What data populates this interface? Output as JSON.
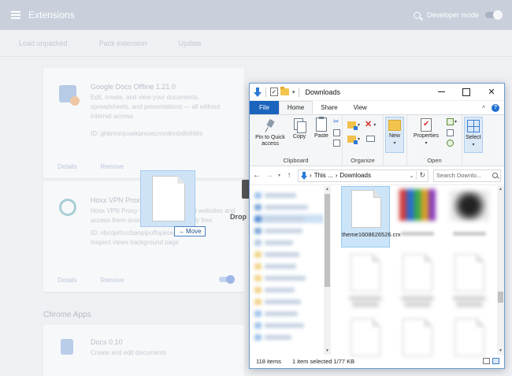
{
  "chrome": {
    "title": "Extensions",
    "developer_mode_label": "Developer mode",
    "toolbar": [
      "Load unpacked",
      "Pack extension",
      "Update"
    ],
    "extensions": [
      {
        "name": "Google Docs Offline   1.21.0",
        "desc": "Edit, create, and view your documents, spreadsheets, and presentations — all without internet access.",
        "id": "ID: ghbmnnjooekpmoecnnnilnnbdlolhkhi",
        "actions": [
          "Details",
          "Remove"
        ]
      },
      {
        "name": "Hoxx VPN Proxy   3.6.2",
        "desc": "Hoxx VPN Proxy — unblock restricted websites and access them anonymously. Completely free.",
        "id": "ID: nbcojefnccbanplpoffopkoepjmhgdgh",
        "extra": "Inspect views background page",
        "actions": [
          "Details",
          "Remove"
        ]
      }
    ],
    "section": "Chrome Apps",
    "app": {
      "name": "Docs   0.10",
      "desc": "Create and edit documents"
    }
  },
  "drag": {
    "tooltip": "Move",
    "drop_label": "Drop"
  },
  "explorer": {
    "title": "Downloads",
    "tabs": [
      "File",
      "Home",
      "Share",
      "View"
    ],
    "active_tab": "Home",
    "ribbon": {
      "pin_label": "Pin to Quick access",
      "copy_label": "Copy",
      "paste_label": "Paste",
      "clipboard_group": "Clipboard",
      "organize_group": "Organize",
      "new_label": "New",
      "properties_label": "Properties",
      "open_group": "Open",
      "select_label": "Select"
    },
    "address": {
      "ellipsis": "This ...",
      "separator": "›",
      "current": "Downloads"
    },
    "search_placeholder": "Search Downlo...",
    "selected_file": "theme1608626526.crx",
    "status": {
      "items": "118 items",
      "selection": "1 item selected  1/77 KB"
    }
  }
}
